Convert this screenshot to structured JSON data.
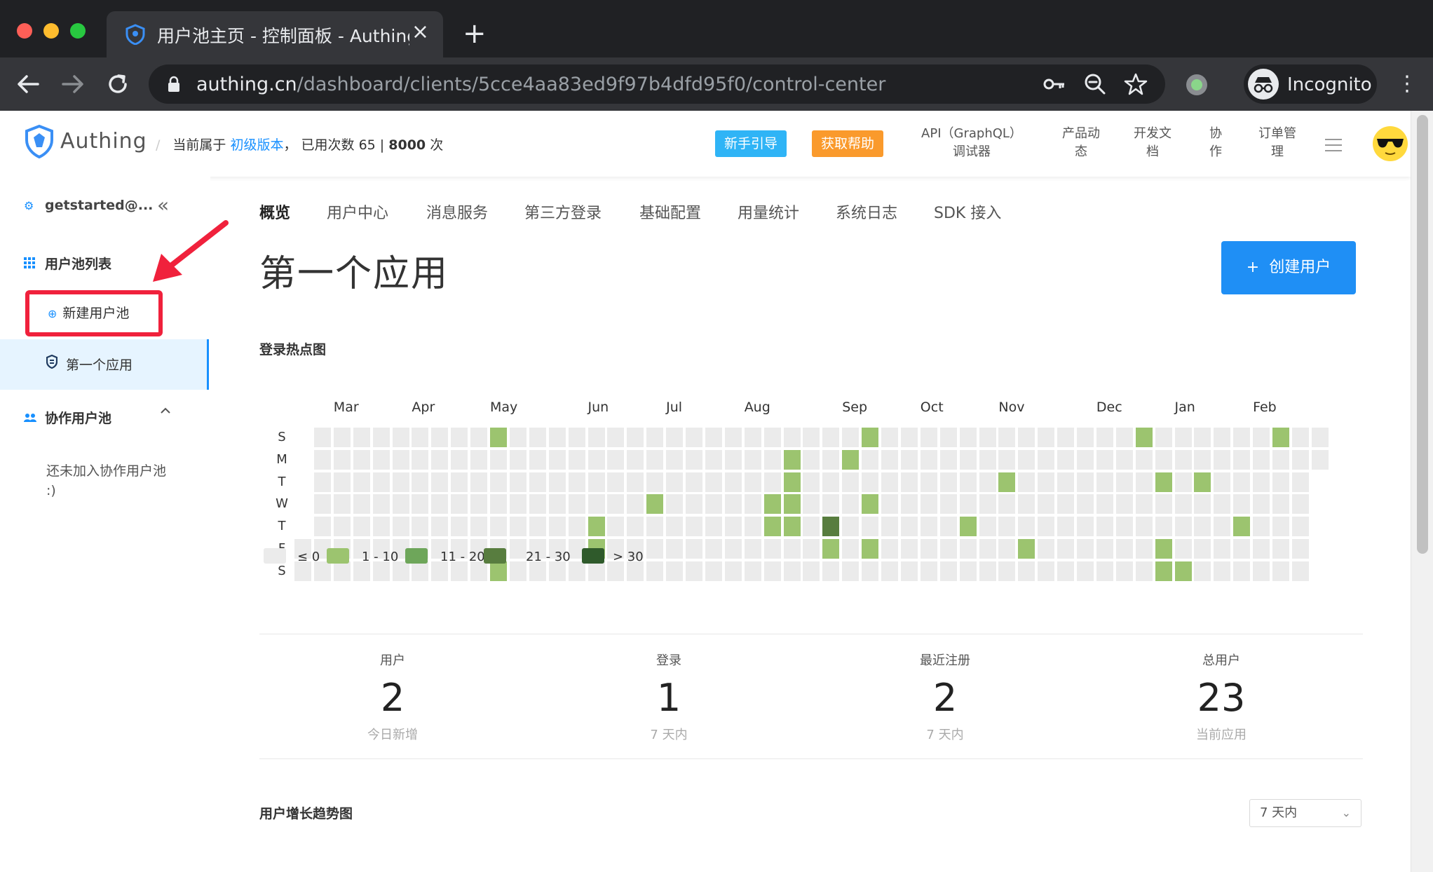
{
  "browser": {
    "tab_title": "用户池主页 - 控制面板 - Authing",
    "url_host": "authing.cn",
    "url_path": "/dashboard/clients/5cce4aa83ed9f97b4dfd95f0/control-center",
    "profile_label": "Incognito"
  },
  "header": {
    "logo_text": "Authing",
    "version_prefix": "当前属于",
    "version_link": "初级版本",
    "usage_prefix": "， 已用次数",
    "usage_used": "65",
    "usage_total": "8000",
    "usage_unit": "次",
    "guide_button": "新手引导",
    "help_button": "获取帮助",
    "links": [
      {
        "line1": "API（GraphQL）",
        "line2": "调试器"
      },
      {
        "line1": "产品动",
        "line2": "态"
      },
      {
        "line1": "开发文",
        "line2": "档"
      },
      {
        "line1": "协",
        "line2": "作"
      },
      {
        "line1": "订单管",
        "line2": "理"
      }
    ],
    "colors": {
      "guide": "#2fb4f6",
      "help": "#fa9a2c",
      "accent": "#1890ff"
    }
  },
  "sidebar": {
    "account": "getstarted@...",
    "collapse_icon": "double-chevron-left-icon",
    "pool_list_label": "用户池列表",
    "new_pool_label": "新建用户池",
    "active_app_label": "第一个应用",
    "collab_label": "协作用户池",
    "collab_empty_line1": "还未加入协作用户池",
    "collab_empty_line2": ":)"
  },
  "main": {
    "tabs": [
      "概览",
      "用户中心",
      "消息服务",
      "第三方登录",
      "基础配置",
      "用量统计",
      "系统日志",
      "SDK 接入"
    ],
    "active_tab": "概览",
    "title": "第一个应用",
    "create_user_label": "创建用户",
    "heatmap_title": "登录热点图",
    "trend_title": "用户增长趋势图",
    "range_value": "7 天内"
  },
  "heatmap": {
    "months": [
      "Mar",
      "Apr",
      "May",
      "Jun",
      "Jul",
      "Aug",
      "Sep",
      "Oct",
      "Nov",
      "Dec",
      "Jan",
      "Feb"
    ],
    "month_start_weeks": [
      2,
      6,
      10,
      15,
      19,
      23,
      28,
      32,
      36,
      41,
      45,
      49
    ],
    "days": [
      "S",
      "M",
      "T",
      "W",
      "T",
      "F",
      "S"
    ],
    "weeks": 53,
    "first_day_row": 5,
    "last_week_rows": 2,
    "active_cells": [
      {
        "w": 10,
        "d": 0
      },
      {
        "w": 10,
        "d": 6
      },
      {
        "w": 15,
        "d": 4
      },
      {
        "w": 15,
        "d": 5
      },
      {
        "w": 18,
        "d": 3
      },
      {
        "w": 24,
        "d": 3
      },
      {
        "w": 24,
        "d": 4
      },
      {
        "w": 25,
        "d": 1
      },
      {
        "w": 25,
        "d": 2
      },
      {
        "w": 25,
        "d": 3
      },
      {
        "w": 25,
        "d": 4
      },
      {
        "w": 27,
        "d": 4,
        "level": 3
      },
      {
        "w": 27,
        "d": 5
      },
      {
        "w": 28,
        "d": 1
      },
      {
        "w": 29,
        "d": 0
      },
      {
        "w": 29,
        "d": 3
      },
      {
        "w": 29,
        "d": 5
      },
      {
        "w": 34,
        "d": 4
      },
      {
        "w": 36,
        "d": 2
      },
      {
        "w": 37,
        "d": 5
      },
      {
        "w": 43,
        "d": 0
      },
      {
        "w": 44,
        "d": 2
      },
      {
        "w": 44,
        "d": 5
      },
      {
        "w": 44,
        "d": 6
      },
      {
        "w": 45,
        "d": 6
      },
      {
        "w": 46,
        "d": 2
      },
      {
        "w": 48,
        "d": 4
      },
      {
        "w": 50,
        "d": 0
      }
    ],
    "legend": [
      {
        "label": "≤ 0",
        "color": "#ebebeb"
      },
      {
        "label": "1 - 10",
        "color": "#9cc46f"
      },
      {
        "label": "11 - 20",
        "color": "#6ea65a"
      },
      {
        "label": "21 - 30",
        "color": "#587d3f"
      },
      {
        "label": "> 30",
        "color": "#2f5a2b"
      }
    ]
  },
  "stats": [
    {
      "label": "用户",
      "value": "2",
      "sub": "今日新增"
    },
    {
      "label": "登录",
      "value": "1",
      "sub": "7 天内"
    },
    {
      "label": "最近注册",
      "value": "2",
      "sub": "7 天内"
    },
    {
      "label": "总用户",
      "value": "23",
      "sub": "当前应用"
    }
  ]
}
